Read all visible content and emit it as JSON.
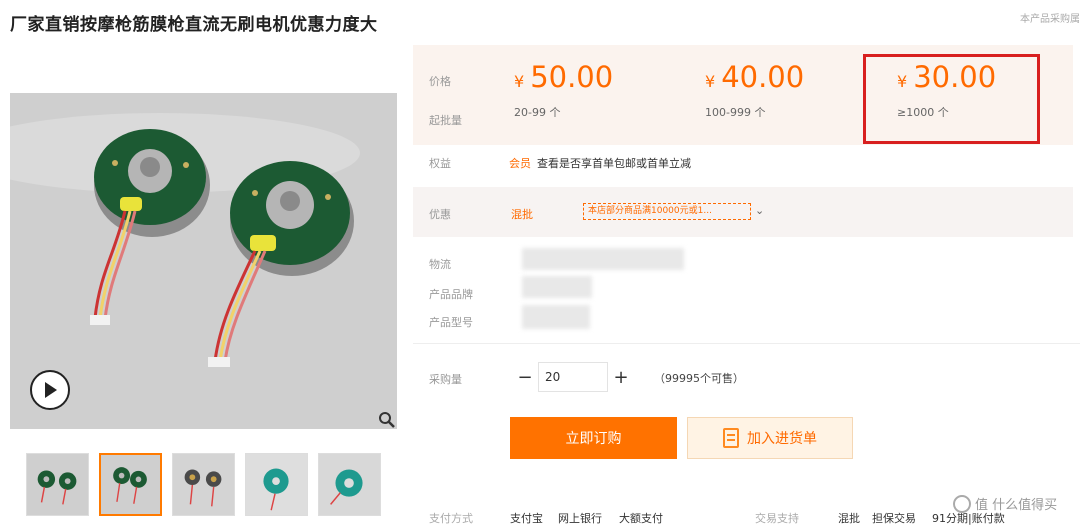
{
  "product": {
    "title": "厂家直销按摩枪筋膜枪直流无刷电机优惠力度大",
    "top_right_note": "本产品采购属",
    "colors": {
      "accent": "#ff6a00",
      "highlight": "#d81f1f"
    }
  },
  "media": {
    "play_icon": "play-icon",
    "zoom_icon": "magnifier-icon",
    "thumbnail_count": 5,
    "active_thumbnail": 2
  },
  "pricing": {
    "price_label": "价格",
    "qty_label": "起批量",
    "currency": "¥",
    "tiers": [
      {
        "price": "50.00",
        "qty": "20-99 个"
      },
      {
        "price": "40.00",
        "qty": "100-999 个"
      },
      {
        "price": "30.00",
        "qty": "≥1000 个"
      }
    ]
  },
  "benefit": {
    "label": "权益",
    "tag": "会员",
    "text": "查看是否享首单包邮或首单立减"
  },
  "promotion": {
    "label": "优惠",
    "mix": "混批",
    "tag": "本店部分商品满10000元或1...",
    "chevron": "chevron-down-icon"
  },
  "info": {
    "logistics_label": "物流",
    "brand_label": "产品品牌",
    "model_label": "产品型号"
  },
  "purchase": {
    "qty_label": "采购量",
    "minus": "−",
    "plus": "+",
    "quantity": "20",
    "stock": "（99995个可售）",
    "buy_label": "立即订购",
    "cart_label": "加入进货单"
  },
  "footer": {
    "payment_label": "支付方式",
    "payments": [
      "支付宝",
      "网上银行",
      "大额支付"
    ],
    "trade_label": "交易支持",
    "trade_items": [
      "混批",
      "担保交易",
      "91分期|账付款"
    ],
    "watermark": "值 什么值得买"
  }
}
